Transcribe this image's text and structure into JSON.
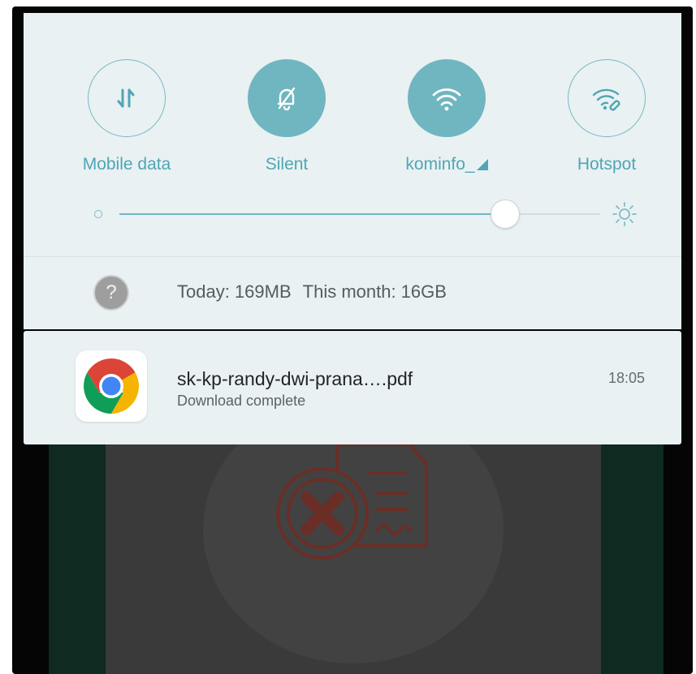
{
  "quick_settings": {
    "tiles": [
      {
        "label": "Mobile data",
        "icon": "mobile-data-icon",
        "active": false
      },
      {
        "label": "Silent",
        "icon": "bell-off-icon",
        "active": true
      },
      {
        "label": "kominfo_",
        "icon": "wifi-icon",
        "active": true
      },
      {
        "label": "Hotspot",
        "icon": "hotspot-icon",
        "active": false
      }
    ],
    "brightness_level": 0.8
  },
  "data_usage": {
    "today": "Today: 169MB",
    "month": "This month: 16GB"
  },
  "notification": {
    "app": "Chrome",
    "title": "sk-kp-randy-dwi-prana….pdf",
    "subtitle": "Download complete",
    "time": "18:05"
  },
  "colors": {
    "accent": "#6fb6c0",
    "label": "#4fa6b4",
    "panel": "#e9f1f3"
  }
}
